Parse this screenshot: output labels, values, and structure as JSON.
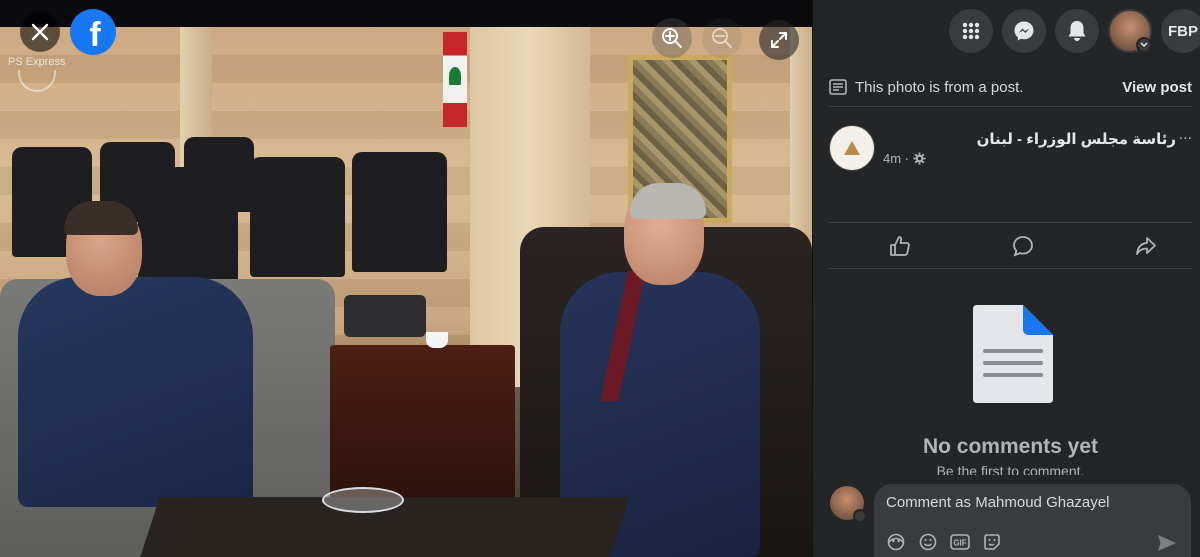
{
  "photo_overlay": {
    "watermark": "PS Express",
    "close_label": "×",
    "fb_letter": "f"
  },
  "topbar": {
    "profile_initials": "FBP"
  },
  "post_note": {
    "text": "This photo is from a post.",
    "view_post": "View post"
  },
  "post": {
    "page_name": "رئاسة مجلس الوزراء - لبنان",
    "more": "...",
    "time": "4m ·"
  },
  "comments": {
    "empty_title": "No comments yet",
    "empty_sub": "Be the first to comment."
  },
  "composer": {
    "placeholder": "Comment as Mahmoud Ghazayel",
    "gif": "GIF"
  },
  "colors": {
    "panel_bg": "#242526",
    "facebook_blue": "#1877f2",
    "button_bg": "#3a3b3c"
  }
}
